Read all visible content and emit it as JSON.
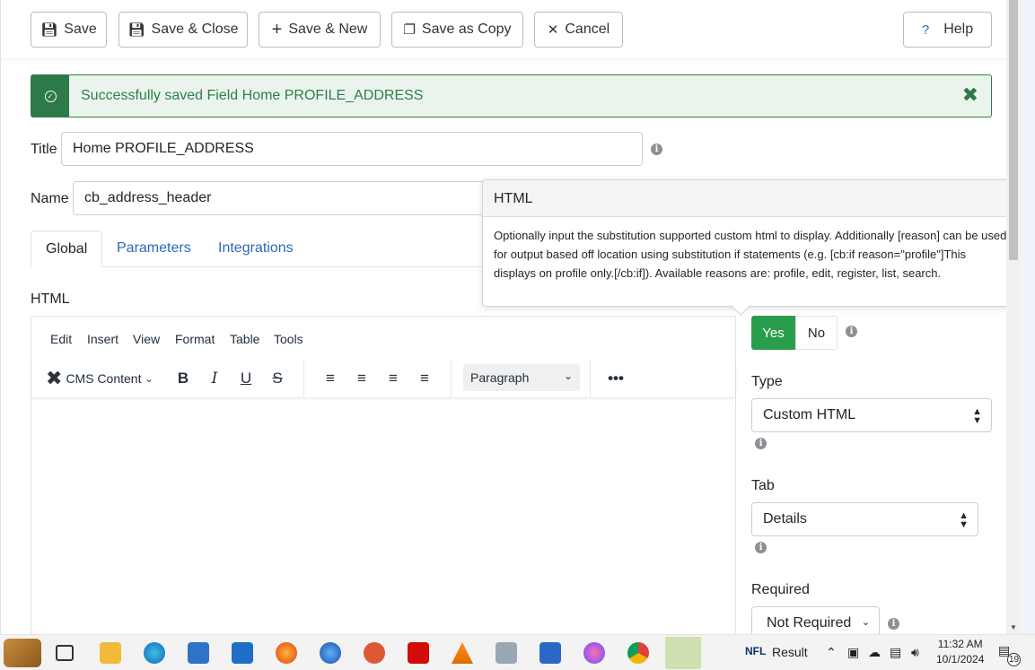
{
  "toolbar": {
    "save": "Save",
    "save_close": "Save & Close",
    "save_new": "Save & New",
    "save_copy": "Save as Copy",
    "cancel": "Cancel",
    "help": "Help"
  },
  "alert": {
    "message": "Successfully saved Field Home PROFILE_ADDRESS"
  },
  "form": {
    "title_label": "Title",
    "title_value": "Home PROFILE_ADDRESS",
    "name_label": "Name",
    "name_value": "cb_address_header",
    "html_label": "HTML"
  },
  "tabs": [
    "Global",
    "Parameters",
    "Integrations"
  ],
  "editor": {
    "menu": [
      "Edit",
      "Insert",
      "View",
      "Format",
      "Table",
      "Tools"
    ],
    "cms_content": "CMS Content",
    "block_format": "Paragraph"
  },
  "popover": {
    "title": "HTML",
    "body": "Optionally input the substitution supported custom html to display. Additionally [reason] can be used for output based off location using substitution if statements (e.g. [cb:if reason=\"profile\"]This displays on profile only.[/cb:if]). Available reasons are: profile, edit, register, list, search."
  },
  "right": {
    "yes": "Yes",
    "no": "No",
    "type_label": "Type",
    "type_value": "Custom HTML",
    "tab_label": "Tab",
    "tab_value": "Details",
    "required_label": "Required",
    "required_value": "Not Required"
  },
  "taskbar": {
    "weather": "Result",
    "time": "11:32 AM",
    "date": "10/1/2024",
    "notifications": "19"
  },
  "colors": {
    "success": "#2a9d4b",
    "alert_border": "#2f7d4a",
    "link": "#2a69b8"
  }
}
